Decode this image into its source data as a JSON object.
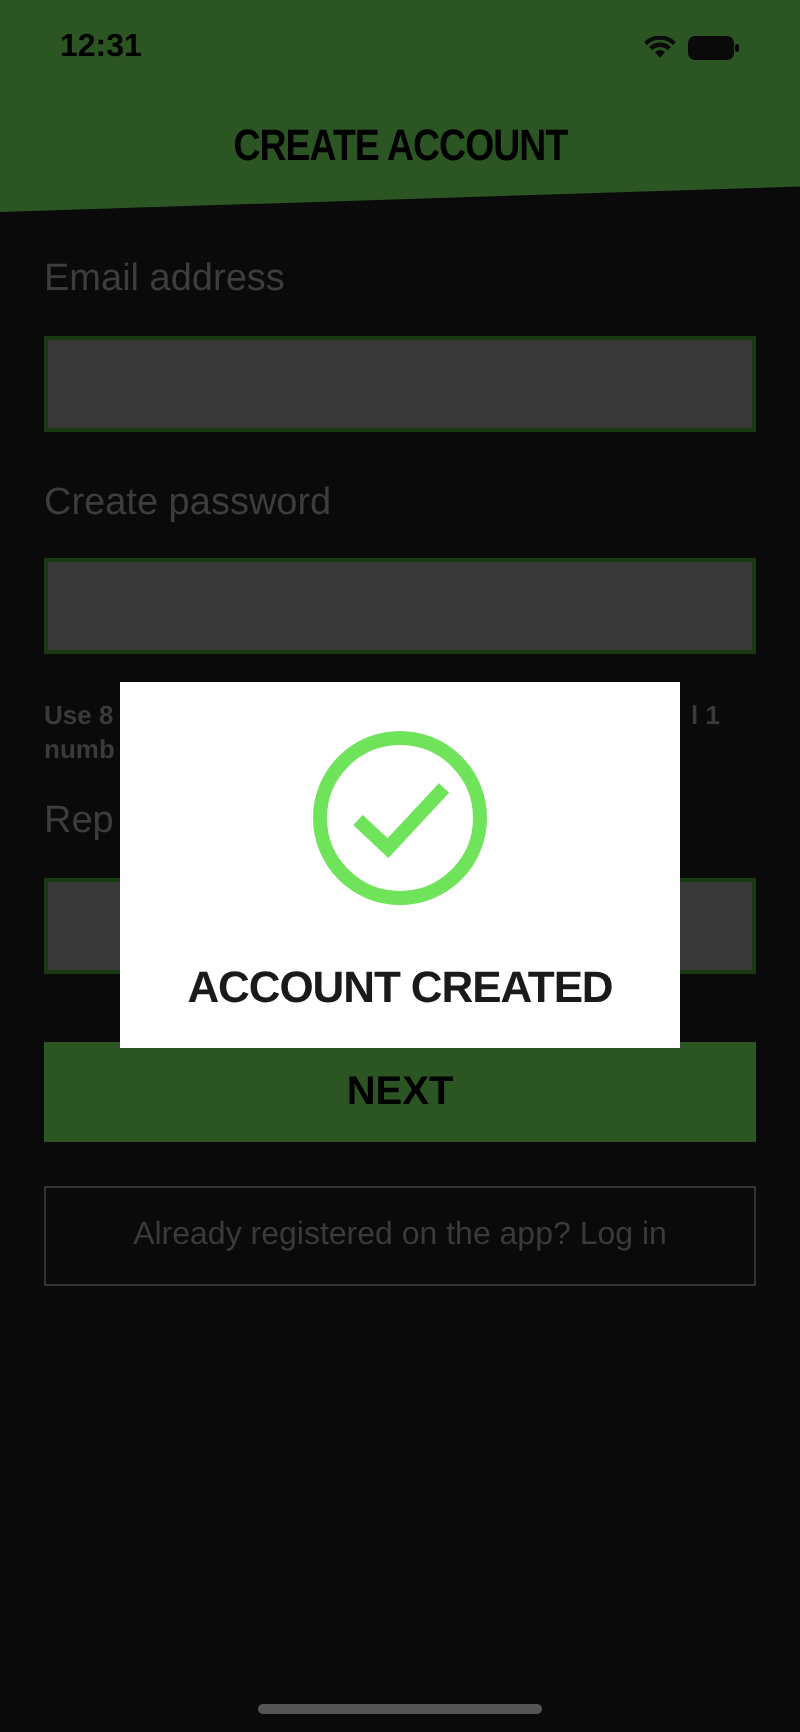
{
  "status_bar": {
    "time": "12:31"
  },
  "header": {
    "title": "CREATE ACCOUNT"
  },
  "form": {
    "fields": [
      {
        "label": "Email address"
      },
      {
        "label": "Create password",
        "hint": {
          "left": "Use 8",
          "right": "l 1",
          "second_line": "numb"
        }
      },
      {
        "label": "Rep"
      }
    ]
  },
  "next_button": {
    "label": "NEXT"
  },
  "login_link": {
    "label": "Already registered on the app? Log in"
  },
  "dialog": {
    "message": "ACCOUNT CREATED"
  }
}
